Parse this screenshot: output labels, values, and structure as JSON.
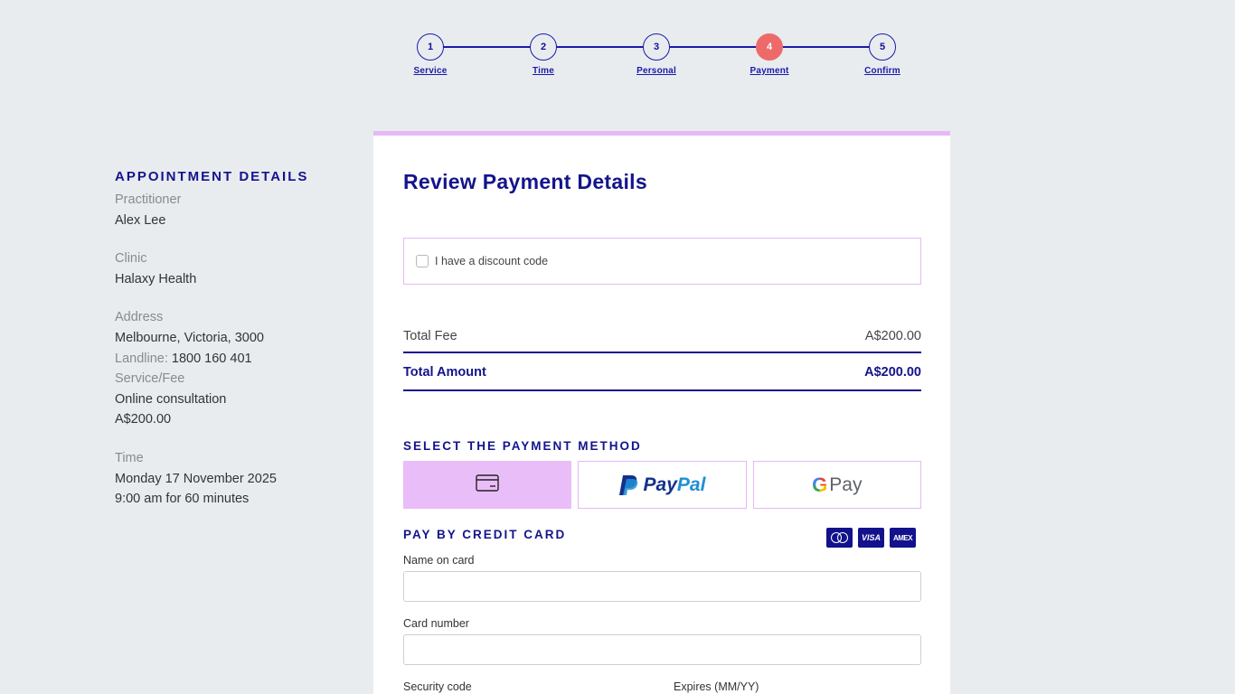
{
  "stepper": {
    "steps": [
      {
        "number": "1",
        "label": "Service"
      },
      {
        "number": "2",
        "label": "Time"
      },
      {
        "number": "3",
        "label": "Personal"
      },
      {
        "number": "4",
        "label": "Payment"
      },
      {
        "number": "5",
        "label": "Confirm"
      }
    ],
    "active_index": 3,
    "active_color": "#ee6a6a"
  },
  "details": {
    "heading": "APPOINTMENT DETAILS",
    "practitioner_label": "Practitioner",
    "practitioner": "Alex Lee",
    "clinic_label": "Clinic",
    "clinic": "Halaxy Health",
    "address_label": "Address",
    "address": "Melbourne, Victoria, 3000",
    "landline_label": "Landline:",
    "landline": "1800 160 401",
    "service_label": "Service/Fee",
    "service": "Online consultation",
    "fee": "A$200.00",
    "time_label": "Time",
    "date": "Monday 17 November 2025",
    "time": "9:00 am for 60 minutes"
  },
  "payment": {
    "title": "Review Payment Details",
    "discount_label": "I have a discount code",
    "total_fee_label": "Total Fee",
    "total_fee": "A$200.00",
    "total_amount_label": "Total Amount",
    "total_amount": "A$200.00",
    "method_heading": "SELECT THE PAYMENT METHOD",
    "methods": [
      "credit-card",
      "PayPal",
      "G Pay"
    ],
    "selected_method": "credit-card",
    "paypal_text_1": "Pay",
    "paypal_text_2": "Pal",
    "gpay_g": "G",
    "gpay_text": "Pay",
    "credit_heading": "PAY BY CREDIT CARD",
    "brands": [
      "mastercard",
      "VISA",
      "AMEX"
    ],
    "visa_text": "VISA",
    "amex_text": "AMEX",
    "name_label": "Name on card",
    "name_value": "",
    "card_number_label": "Card number",
    "card_number_value": "",
    "security_label": "Security code",
    "expires_label": "Expires (MM/YY)"
  },
  "colors": {
    "primary": "#14148c",
    "accent_pink": "#e6b9f6",
    "background": "#e9ecef"
  }
}
